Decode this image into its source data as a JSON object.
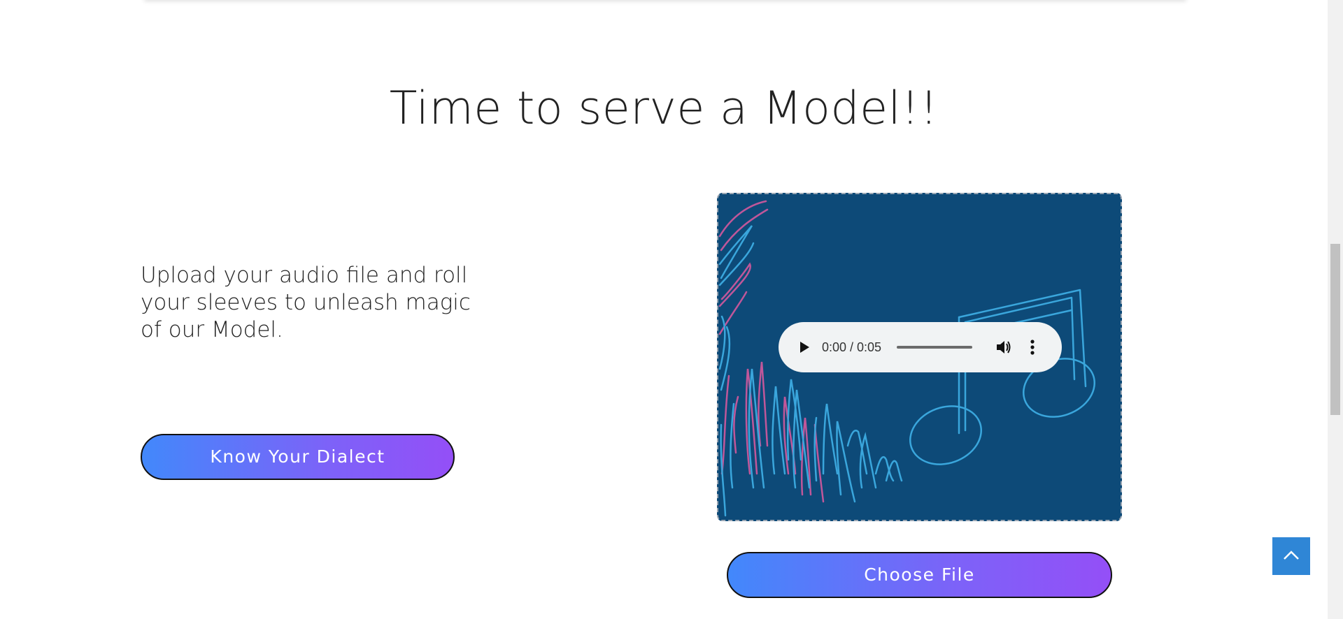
{
  "section": {
    "title": "Time to serve a Model!!",
    "description": "Upload your audio file and roll your sleeves to unleash magic of our Model."
  },
  "buttons": {
    "dialect_label": "Know Your Dialect",
    "choose_file_label": "Choose File"
  },
  "audio_player": {
    "time_display": "0:00 / 0:05",
    "progress": 0
  },
  "icons": {
    "play": "play-icon",
    "volume": "volume-icon",
    "more": "more-vertical-icon",
    "back_to_top": "chevron-up-icon"
  },
  "colors": {
    "media_background": "#0d4a78",
    "button_gradient_start": "#4288fb",
    "button_gradient_end": "#944ff7",
    "back_to_top": "#2f86d6",
    "art_blue": "#3aa6dc",
    "art_pink": "#c0579a"
  }
}
